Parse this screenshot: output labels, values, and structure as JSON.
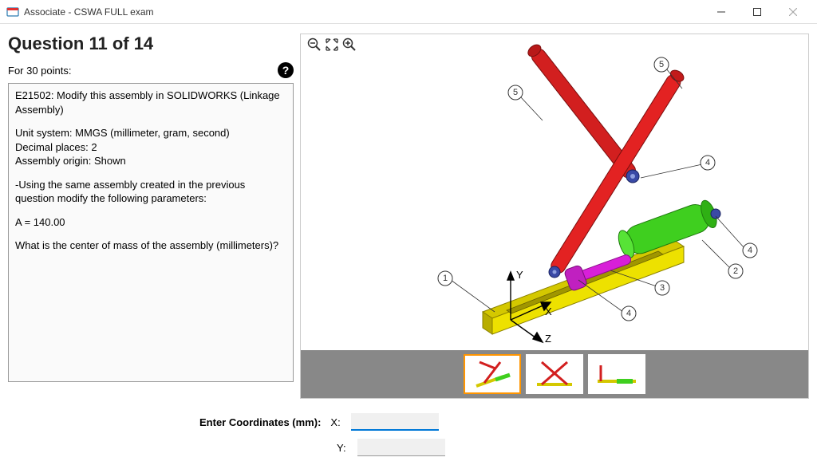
{
  "window": {
    "title": "Associate - CSWA FULL exam"
  },
  "question": {
    "header": "Question 11 of 14",
    "points_label": "For 30 points:",
    "body": {
      "line1": "E21502:  Modify this assembly in SOLIDWORKS (Linkage Assembly)",
      "line2": "Unit system: MMGS (millimeter, gram, second)",
      "line3": "Decimal places: 2",
      "line4": "Assembly origin: Shown",
      "line5": "-Using the same assembly created in the previous question modify the following parameters:",
      "line6": "A = 140.00",
      "line7": "What is the center of mass of the assembly (millimeters)?"
    }
  },
  "answer": {
    "prompt": "Enter Coordinates (mm):",
    "x_label": "X:",
    "y_label": "Y:",
    "x_value": "",
    "y_value": ""
  },
  "viewport": {
    "axis_x": "X",
    "axis_y": "Y",
    "axis_z": "Z",
    "callouts": [
      "1",
      "2",
      "3",
      "4",
      "4",
      "4",
      "5",
      "5"
    ]
  }
}
